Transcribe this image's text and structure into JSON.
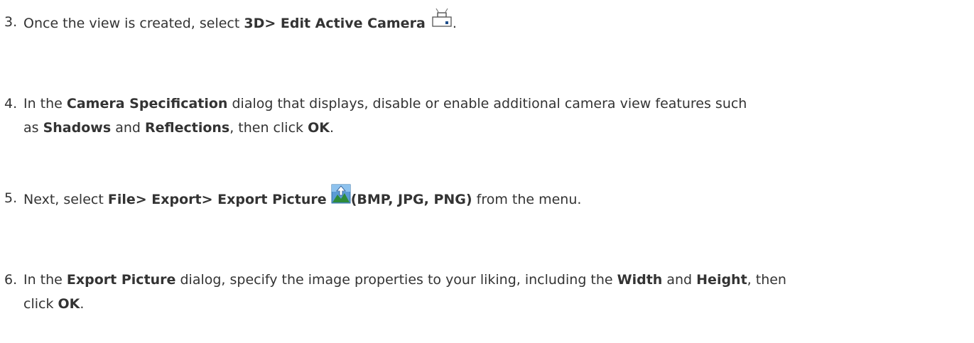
{
  "steps": [
    {
      "number": "3.",
      "parts": {
        "a": "Once the view is created, select ",
        "b": "3D> Edit Active Camera",
        "c": " ",
        "d": "."
      },
      "icon": "camera-icon"
    },
    {
      "number": "4.",
      "parts": {
        "a": "In the ",
        "b": "Camera Specification",
        "c": " dialog that displays, disable or enable additional camera view features such",
        "d": "as ",
        "e": "Shadows",
        "f": " and ",
        "g": "Reflections",
        "h": ", then click ",
        "i": "OK",
        "j": "."
      }
    },
    {
      "number": "5.",
      "parts": {
        "a": "Next, select ",
        "b": "File> Export> Export Picture",
        "c": " ",
        "d": "(BMP, JPG, PNG)",
        "e": " from the menu."
      },
      "icon": "export-picture-icon"
    },
    {
      "number": "6.",
      "parts": {
        "a": "In the ",
        "b": "Export Picture",
        "c": " dialog, specify the image properties to your liking, including the ",
        "d": "Width",
        "e": " and ",
        "f": "Height",
        "g": ", then",
        "h": "click ",
        "i": "OK",
        "j": "."
      }
    }
  ]
}
